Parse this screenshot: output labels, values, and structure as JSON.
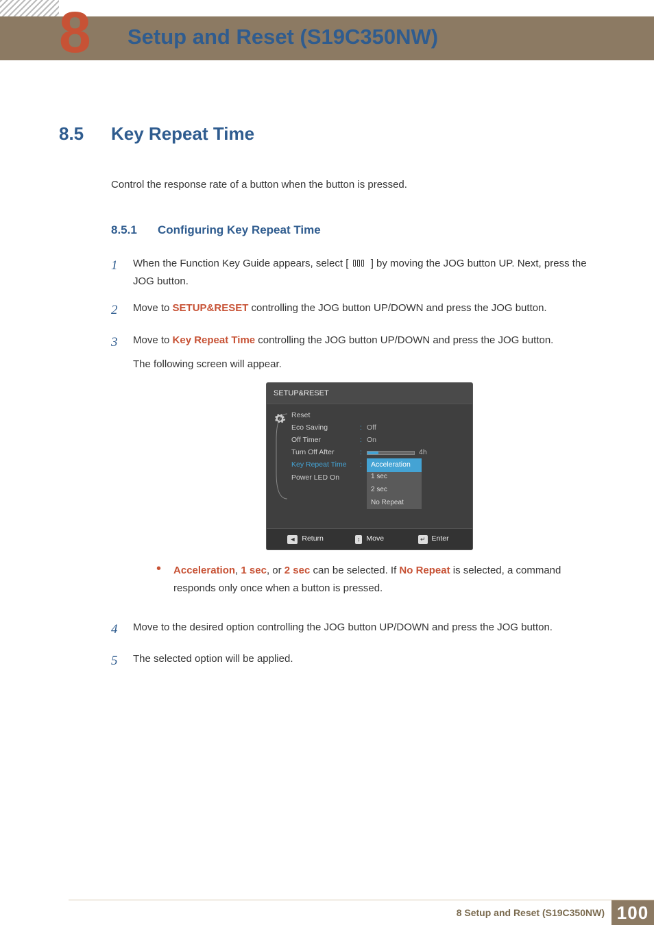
{
  "chapter": {
    "number": "8",
    "title": "Setup and Reset (S19C350NW)"
  },
  "section": {
    "number": "8.5",
    "title": "Key Repeat Time"
  },
  "intro": "Control the response rate of a button when the button is pressed.",
  "subsection": {
    "number": "8.5.1",
    "title": "Configuring Key Repeat Time"
  },
  "steps": {
    "s1_num": "1",
    "s1_a": "When the Function Key Guide appears, select ",
    "s1_b": " by moving the JOG button UP. Next, press the JOG button.",
    "s2_num": "2",
    "s2_a": "Move to ",
    "s2_hl": "SETUP&RESET",
    "s2_b": " controlling the JOG button UP/DOWN and press the JOG button.",
    "s3_num": "3",
    "s3_a": "Move to ",
    "s3_hl": "Key Repeat Time",
    "s3_b": " controlling the JOG button UP/DOWN and press the JOG button.",
    "s3_c": "The following screen will appear.",
    "s4_num": "4",
    "s4": "Move to the desired option controlling the JOG button UP/DOWN and press the JOG button.",
    "s5_num": "5",
    "s5": "The selected option will be applied."
  },
  "bullet": {
    "w1": "Acceleration",
    "sep1": ", ",
    "w2": "1 sec",
    "sep2": ", or  ",
    "w3": "2 sec",
    "mid": " can be selected. If ",
    "w4": "No Repeat",
    "end": " is selected, a command responds only once when a button is pressed."
  },
  "osd": {
    "title": "SETUP&RESET",
    "rows": {
      "reset": "Reset",
      "eco": "Eco Saving",
      "eco_val": "Off",
      "timer": "Off Timer",
      "timer_val": "On",
      "turnoff": "Turn Off After",
      "turnoff_val": "4h",
      "krt": "Key Repeat Time",
      "krt_val": "Acceleration",
      "pled": "Power LED On"
    },
    "options": {
      "o1": "1 sec",
      "o2": "2 sec",
      "o3": "No Repeat"
    },
    "footer": {
      "return": "Return",
      "move": "Move",
      "enter": "Enter"
    }
  },
  "footer": {
    "text": "8 Setup and Reset (S19C350NW)",
    "page": "100"
  }
}
